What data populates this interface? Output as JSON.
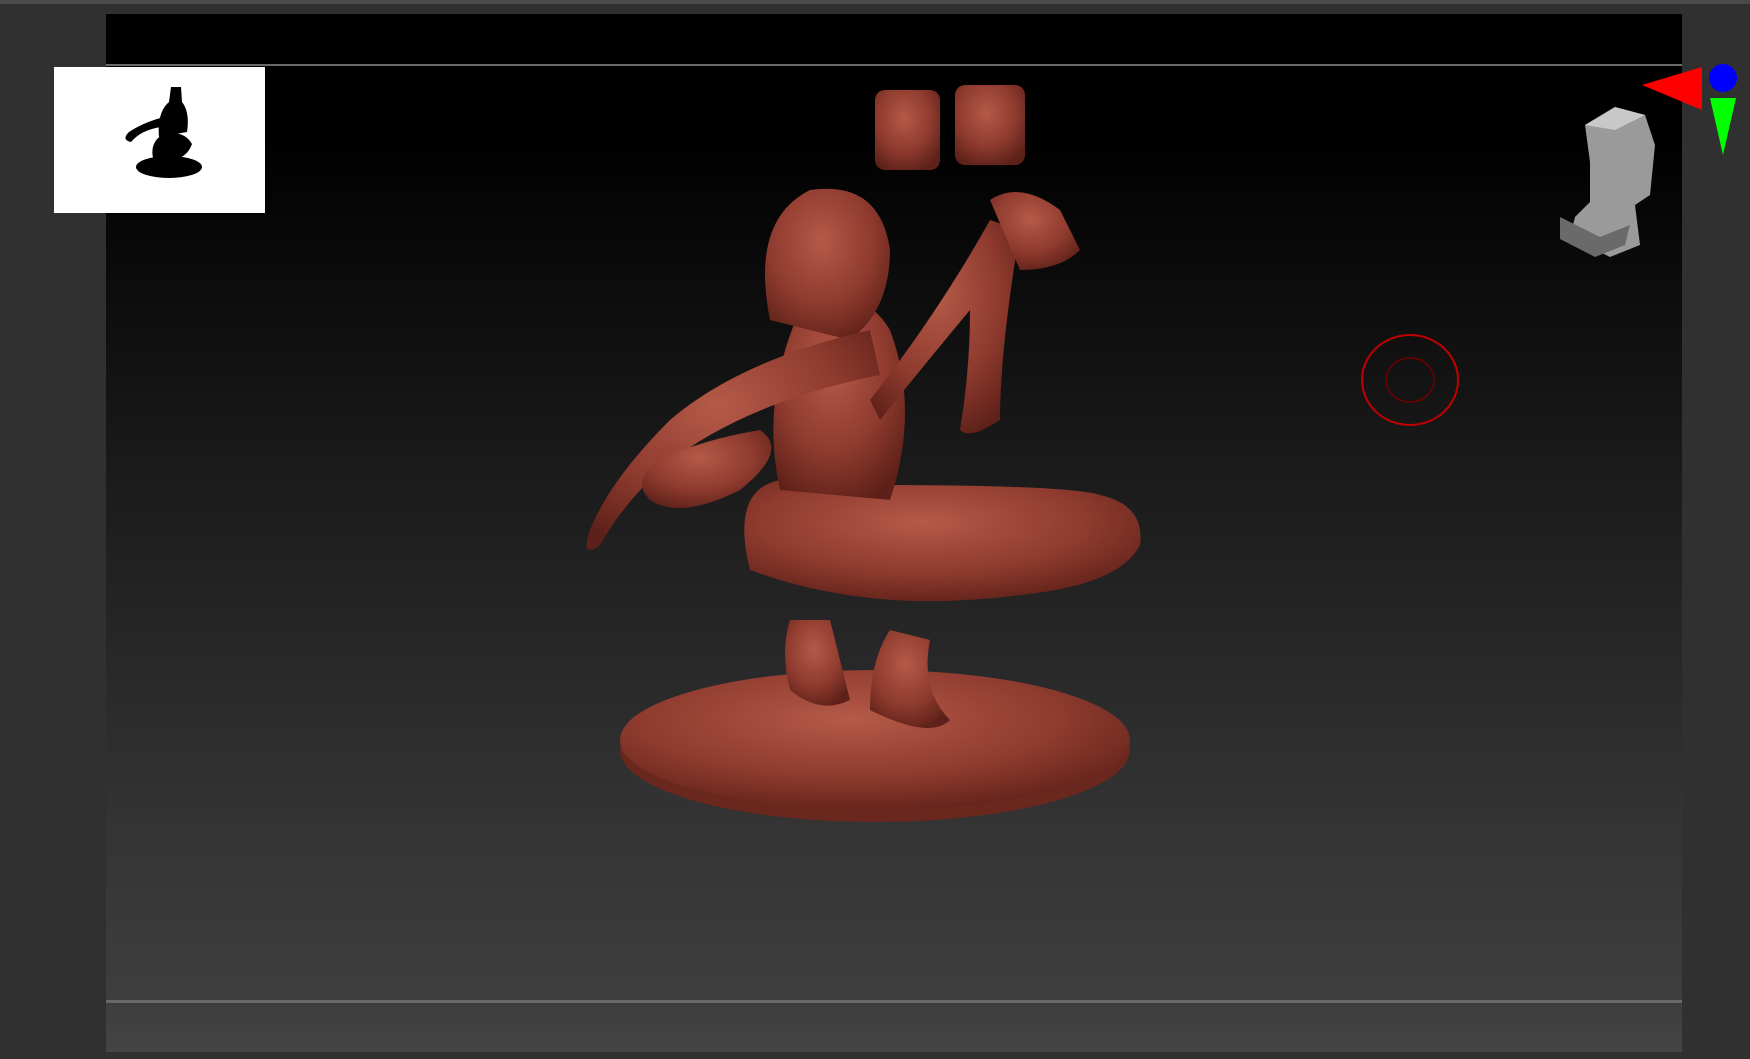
{
  "app": {
    "type": "3d-sculpting-viewport"
  },
  "colors": {
    "background": "#303030",
    "model": "#8e3a2e",
    "axis_x": "#ff0000",
    "axis_y": "#00ff00",
    "axis_z": "#0000ff",
    "brush_cursor": "#c00000"
  },
  "icons": [
    "navigation-thumbnail",
    "axis-gizmo-icon",
    "orientation-head-icon",
    "brush-cursor-icon"
  ]
}
